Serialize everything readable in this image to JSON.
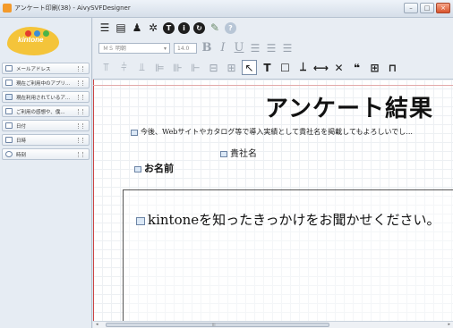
{
  "window": {
    "title": "アンケート印刷(38) - AivySVFDesigner",
    "minimize": "–",
    "maximize": "□",
    "close": "×"
  },
  "logo": {
    "text": "kintone"
  },
  "sidebar": {
    "items": [
      {
        "label": "メールアドレス",
        "icon": "field-icon"
      },
      {
        "label": "現在ご利用中のアプリ...",
        "icon": "table-icon"
      },
      {
        "label": "現在利用されているア...",
        "icon": "checkbox-icon"
      },
      {
        "label": "ご利用の感想や、僕...",
        "icon": "textarea-icon"
      },
      {
        "label": "日付",
        "icon": "calendar-icon"
      },
      {
        "label": "日時",
        "icon": "calendar-icon"
      },
      {
        "label": "時刻",
        "icon": "clock-icon"
      }
    ]
  },
  "toolbar": {
    "font_name": "ＭＳ 明朝",
    "font_size": "14.0",
    "bold": "B",
    "italic": "I",
    "underline": "U",
    "text_tool": "T",
    "dropdown_arrow": "▾"
  },
  "canvas": {
    "title": "アンケート結果",
    "note": "今後、Webサイトやカタログ等で導入実績として貴社名を掲載してもよろしいでし...",
    "company_label": "貴社名",
    "name_label": "お名前",
    "question": "kintoneを知ったきっかけをお聞かせください。"
  },
  "scrollbar": {
    "left": "◂",
    "right": "▸",
    "grip": "III"
  }
}
